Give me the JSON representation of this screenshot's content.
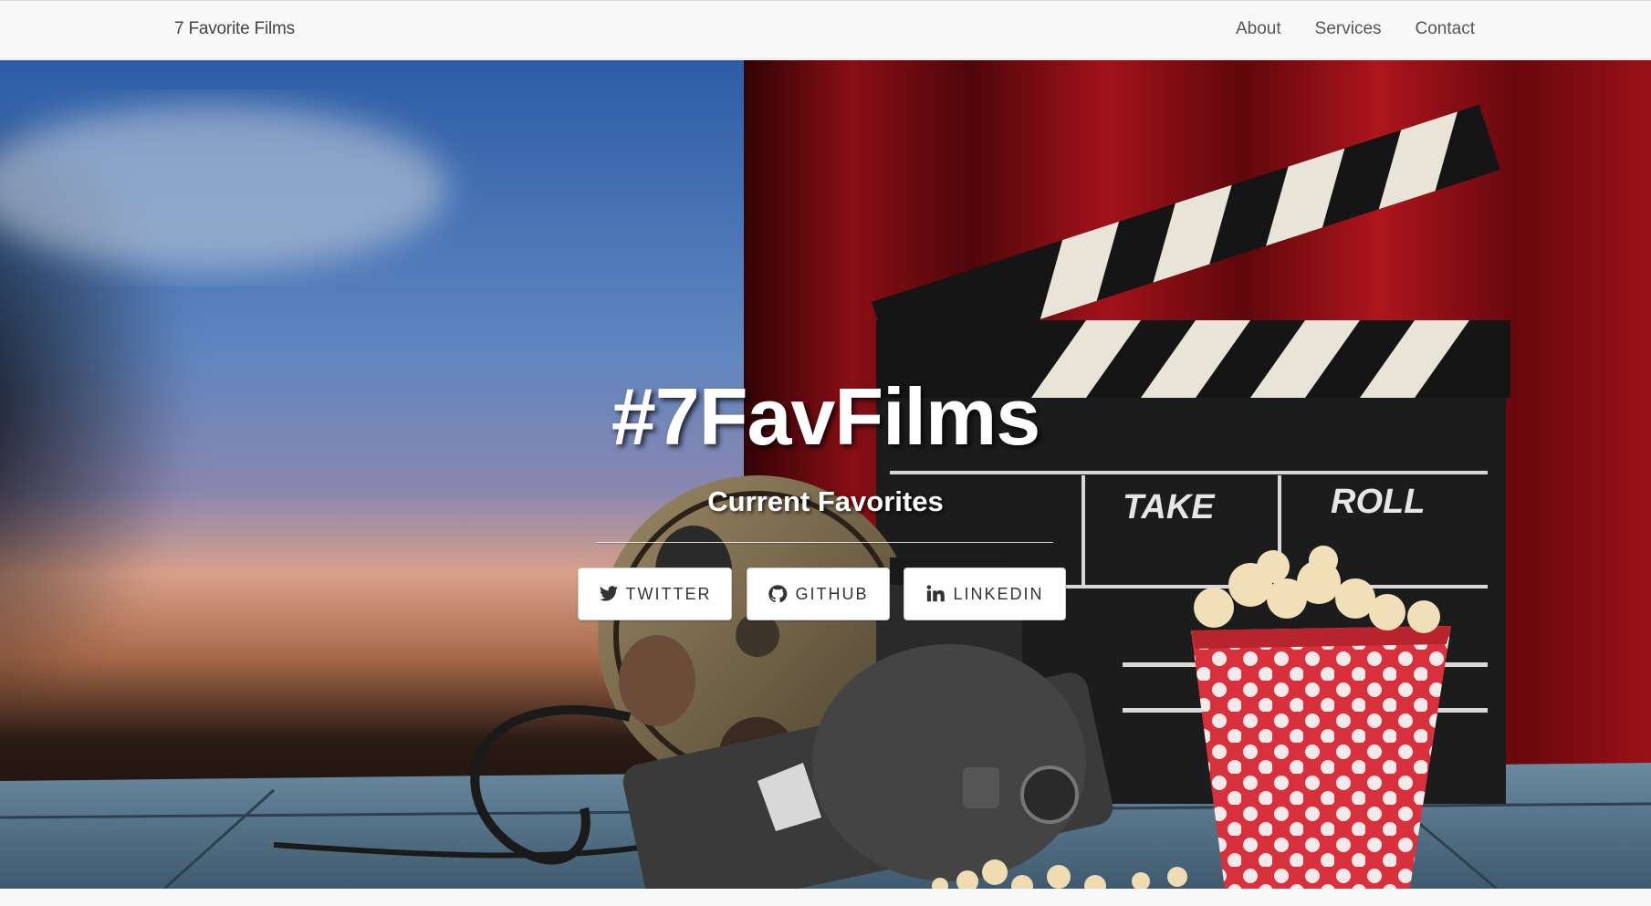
{
  "navbar": {
    "brand": "7 Favorite Films",
    "links": [
      {
        "label": "About"
      },
      {
        "label": "Services"
      },
      {
        "label": "Contact"
      }
    ]
  },
  "hero": {
    "title": "#7FavFilms",
    "subtitle": "Current Favorites",
    "clapper_take": "TAKE",
    "clapper_roll": "ROLL",
    "buttons": [
      {
        "label": "TWITTER",
        "icon": "twitter-icon"
      },
      {
        "label": "GITHUB",
        "icon": "github-icon"
      },
      {
        "label": "LINKEDIN",
        "icon": "linkedin-icon"
      }
    ]
  },
  "colors": {
    "navbar_bg": "#f8f8f8",
    "curtain_red": "#b3121a",
    "sky_blue": "#3f6fb3",
    "popcorn_red": "#d8303c"
  }
}
